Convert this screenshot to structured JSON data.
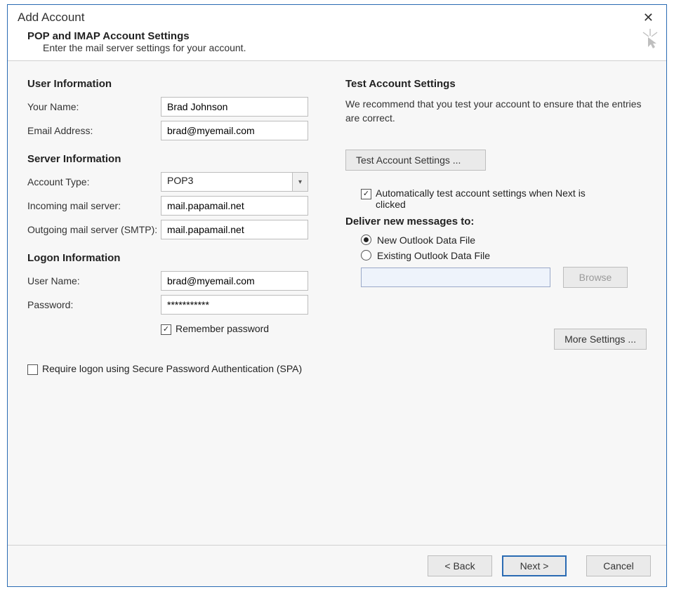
{
  "titlebar": {
    "title": "Add Account"
  },
  "subheader": {
    "subtitle": "POP and IMAP Account Settings",
    "desc": "Enter the mail server settings for your account."
  },
  "left": {
    "user_info_head": "User Information",
    "your_name_label": "Your Name:",
    "your_name_value": "Brad Johnson",
    "email_label": "Email Address:",
    "email_value": "brad@myemail.com",
    "server_info_head": "Server Information",
    "account_type_label": "Account Type:",
    "account_type_value": "POP3",
    "incoming_label": "Incoming mail server:",
    "incoming_value": "mail.papamail.net",
    "outgoing_label": "Outgoing mail server (SMTP):",
    "outgoing_value": "mail.papamail.net",
    "logon_info_head": "Logon Information",
    "username_label": "User Name:",
    "username_value": "brad@myemail.com",
    "password_label": "Password:",
    "password_value": "***********",
    "remember_label": "Remember password",
    "spa_label": "Require logon using Secure Password Authentication (SPA)"
  },
  "right": {
    "test_head": "Test Account Settings",
    "test_desc": "We recommend that you test your account to ensure that the entries are correct.",
    "test_btn": "Test Account Settings ...",
    "auto_test_label": "Automatically test account settings when Next is clicked",
    "deliver_head": "Deliver new messages to:",
    "new_file_label": "New Outlook Data File",
    "existing_file_label": "Existing Outlook Data File",
    "browse_btn": "Browse",
    "more_btn": "More Settings ..."
  },
  "footer": {
    "back": "< Back",
    "next": "Next >",
    "cancel": "Cancel"
  }
}
